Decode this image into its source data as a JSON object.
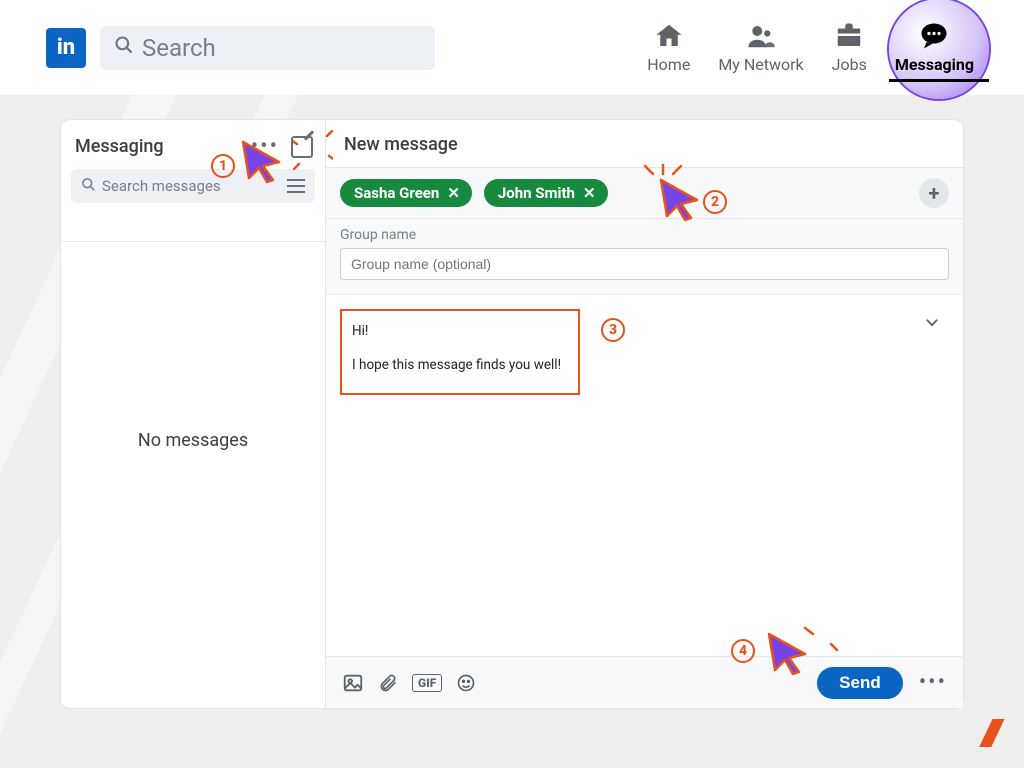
{
  "navbar": {
    "logo_text": "in",
    "search_placeholder": "Search",
    "items": [
      {
        "label": "Home",
        "icon": "home-icon"
      },
      {
        "label": "My Network",
        "icon": "people-icon"
      },
      {
        "label": "Jobs",
        "icon": "briefcase-icon"
      },
      {
        "label": "Messaging",
        "icon": "messaging-icon"
      }
    ],
    "active_index": 3
  },
  "left_panel": {
    "title": "Messaging",
    "search_placeholder": "Search messages",
    "empty_text": "No messages"
  },
  "compose": {
    "title": "New message",
    "recipients": [
      {
        "name": "Sasha Green"
      },
      {
        "name": "John Smith"
      }
    ],
    "group_label": "Group name",
    "group_placeholder": "Group name (optional)",
    "body_line1": "Hi!",
    "body_line2": "I hope this message finds you well!",
    "footer": {
      "gif_label": "GIF",
      "send_label": "Send"
    }
  },
  "annotations": {
    "step1": "1",
    "step2": "2",
    "step3": "3",
    "step4": "4"
  },
  "watermark": "///",
  "colors": {
    "accent_orange": "#e8521d",
    "brand_blue": "#0a66c2",
    "chip_green": "#178a3f",
    "ring_purple": "#7843e6"
  }
}
